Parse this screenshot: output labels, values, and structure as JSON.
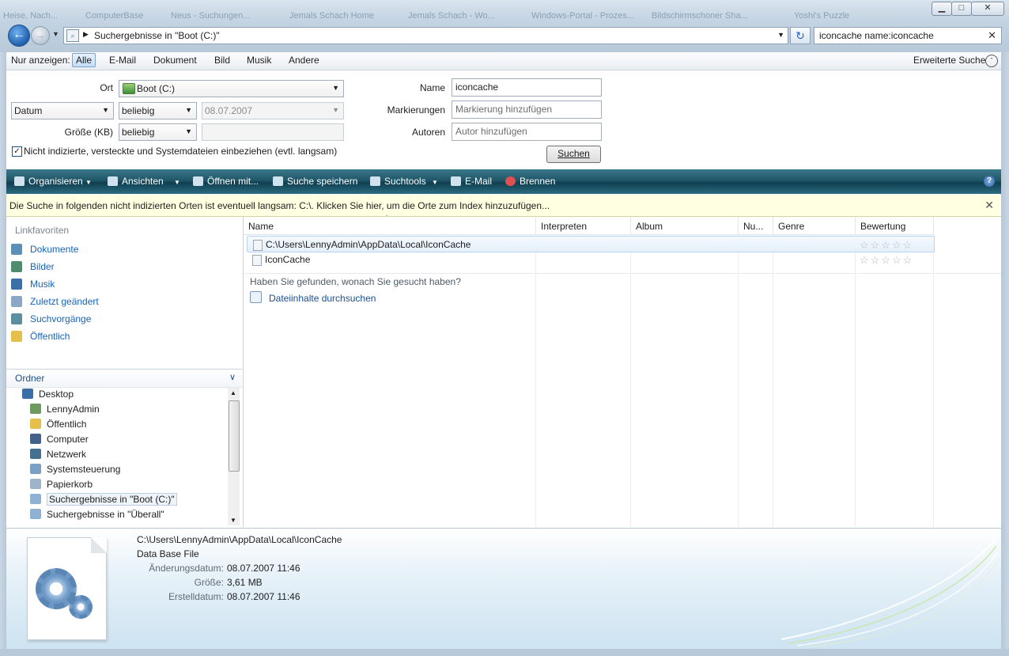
{
  "window": {
    "bg_tabs": [
      "Heise, Nach...",
      "ComputerBase",
      "Neus - Suchungen...",
      "Jemals Schach Home",
      "Jemals Schach - Wo...",
      "Windows-Portal - Prozes...",
      "Bildschirmschoner Sha...",
      "Yoshi's Puzzle"
    ],
    "min_label": "▁",
    "max_label": "□",
    "close_label": "✕"
  },
  "nav": {
    "address": "Suchergebnisse in \"Boot (C:)\"",
    "search_text": "iconcache name:iconcache"
  },
  "filter": {
    "prefix": "Nur anzeigen:",
    "items": [
      "Alle",
      "E-Mail",
      "Dokument",
      "Bild",
      "Musik",
      "Andere"
    ],
    "advanced": "Erweiterte Suche"
  },
  "criteria": {
    "ort_label": "Ort",
    "ort_value": "Boot (C:)",
    "date_type": "Datum",
    "date_mode": "beliebig",
    "date_value": "08.07.2007",
    "size_label": "Größe (KB)",
    "size_mode": "beliebig",
    "checkbox_label": "Nicht indizierte, versteckte und Systemdateien einbeziehen (evtl. langsam)",
    "name_label": "Name",
    "name_value": "iconcache",
    "tags_label": "Markierungen",
    "tags_placeholder": "Markierung hinzufügen",
    "authors_label": "Autoren",
    "authors_placeholder": "Autor hinzufügen",
    "search_button": "Suchen"
  },
  "commands": [
    "Organisieren",
    "Ansichten",
    "Öffnen mit...",
    "Suche speichern",
    "Suchtools",
    "E-Mail",
    "Brennen"
  ],
  "infobar": "Die Suche in folgenden nicht indizierten Orten ist eventuell langsam: C:\\. Klicken Sie hier, um die Orte zum Index hinzuzufügen...",
  "navpane": {
    "header": "Linkfavoriten",
    "links": [
      "Dokumente",
      "Bilder",
      "Musik",
      "Zuletzt geändert",
      "Suchvorgänge",
      "Öffentlich"
    ],
    "folders_header": "Ordner",
    "tree": [
      "Desktop",
      "LennyAdmin",
      "Öffentlich",
      "Computer",
      "Netzwerk",
      "Systemsteuerung",
      "Papierkorb",
      "Suchergebnisse in \"Boot (C:)\"",
      "Suchergebnisse in \"Überall\""
    ]
  },
  "list": {
    "columns": [
      "Name",
      "Interpreten",
      "Album",
      "Nu...",
      "Genre",
      "Bewertung"
    ],
    "rows": [
      {
        "name": "C:\\Users\\LennyAdmin\\AppData\\Local\\IconCache",
        "rating": "☆☆☆☆☆"
      },
      {
        "name": "IconCache",
        "rating": "☆☆☆☆☆"
      }
    ],
    "found_question": "Haben Sie gefunden, wonach Sie gesucht haben?",
    "search_contents": "Dateiinhalte durchsuchen"
  },
  "details": {
    "path": "C:\\Users\\LennyAdmin\\AppData\\Local\\IconCache",
    "type": "Data Base File",
    "modified_label": "Änderungsdatum:",
    "modified_value": "08.07.2007 11:46",
    "size_label": "Größe:",
    "size_value": "3,61 MB",
    "created_label": "Erstelldatum:",
    "created_value": "08.07.2007 11:46"
  },
  "colors": {
    "accent": "#1565b8",
    "command_bar": "#1f5668",
    "info_bar": "#ffffe1"
  }
}
